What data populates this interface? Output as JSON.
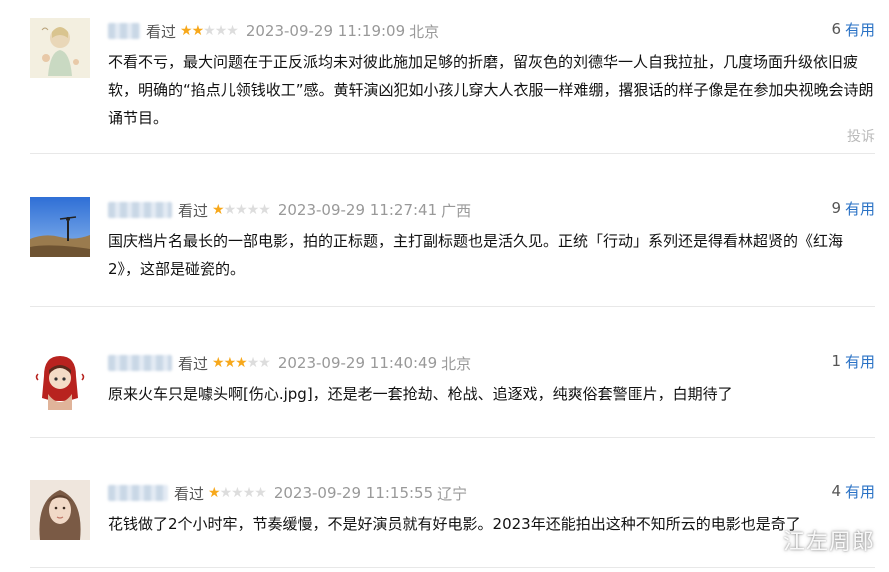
{
  "reviews": [
    {
      "status": "看过",
      "rating": 2,
      "datetime": "2023-09-29 11:19:09",
      "location": "北京",
      "useful_count": "6",
      "useful_label": "有用",
      "content": "不看不亏，最大问题在于正反派均未对彼此施加足够的折磨，留灰色的刘德华一人自我拉扯，几度场面升级依旧疲软，明确的“掐点儿领钱收工”感。黄轩演凶犯如小孩儿穿大人衣服一样难绷，撂狠话的样子像是在参加央视晚会诗朗诵节目。",
      "report_label": "投诉"
    },
    {
      "status": "看过",
      "rating": 1,
      "datetime": "2023-09-29 11:27:41",
      "location": "广西",
      "useful_count": "9",
      "useful_label": "有用",
      "content": "国庆档片名最长的一部电影，拍的正标题，主打副标题也是活久见。正统「行动」系列还是得看林超贤的《红海2》，这部是碰瓷的。"
    },
    {
      "status": "看过",
      "rating": 3,
      "datetime": "2023-09-29 11:40:49",
      "location": "北京",
      "useful_count": "1",
      "useful_label": "有用",
      "content": "原来火车只是噱头啊[伤心.jpg]，还是老一套抢劫、枪战、追逐戏，纯爽俗套警匪片，白期待了"
    },
    {
      "status": "看过",
      "rating": 1,
      "datetime": "2023-09-29 11:15:55",
      "location": "辽宁",
      "useful_count": "4",
      "useful_label": "有用",
      "content": "花钱做了2个小时牢，节奏缓慢，不是好演员就有好电影。2023年还能拍出这种不知所云的电影也是奇了"
    }
  ],
  "star_colors": {
    "filled": "#f7a81b",
    "empty": "#dddddd"
  },
  "link_color": "#2a72c5",
  "watermark": "江左周郎"
}
